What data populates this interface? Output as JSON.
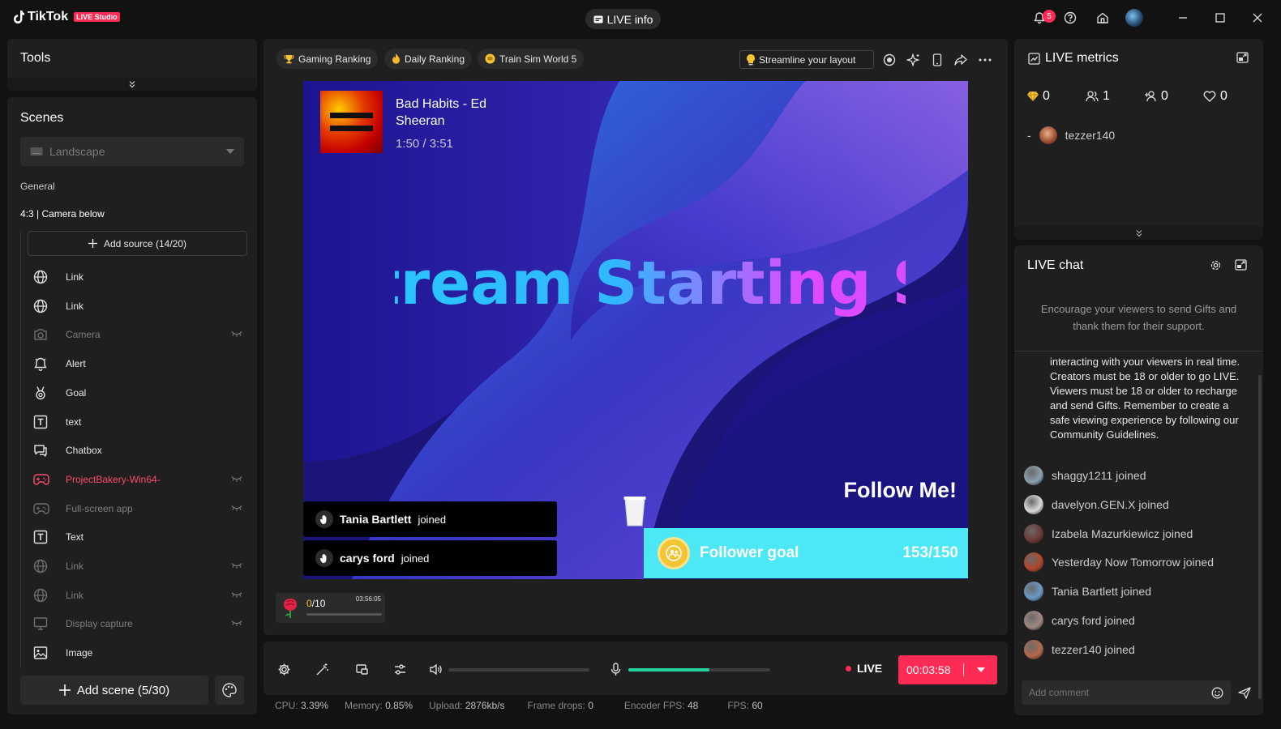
{
  "app": {
    "logo_text": "TikTok",
    "badge": "LIVE Studio",
    "live_info_label": "LIVE info",
    "notification_count": "5"
  },
  "tools": {
    "title": "Tools"
  },
  "scenes": {
    "title": "Scenes",
    "layout_selected": "Landscape",
    "group_label": "General",
    "scene_name": "4:3 | Camera below",
    "add_source_label": "Add source (14/20)",
    "sources": [
      {
        "label": "Link",
        "icon": "globe-icon",
        "state": "normal"
      },
      {
        "label": "Link",
        "icon": "globe-icon",
        "state": "normal"
      },
      {
        "label": "Camera",
        "icon": "camera-icon",
        "state": "hidden"
      },
      {
        "label": "Alert",
        "icon": "bell-icon",
        "state": "normal"
      },
      {
        "label": "Goal",
        "icon": "medal-icon",
        "state": "normal"
      },
      {
        "label": "text",
        "icon": "text-icon",
        "state": "normal"
      },
      {
        "label": "Chatbox",
        "icon": "chat-icon",
        "state": "normal"
      },
      {
        "label": "ProjectBakery-Win64-",
        "icon": "gamepad-icon",
        "state": "error"
      },
      {
        "label": "Full-screen app",
        "icon": "gamepad-icon",
        "state": "hidden"
      },
      {
        "label": "Text",
        "icon": "text-icon",
        "state": "normal"
      },
      {
        "label": "Link",
        "icon": "globe-icon",
        "state": "hidden"
      },
      {
        "label": "Link",
        "icon": "globe-icon",
        "state": "hidden"
      },
      {
        "label": "Display capture",
        "icon": "monitor-icon",
        "state": "hidden"
      },
      {
        "label": "Image",
        "icon": "image-icon",
        "state": "normal"
      }
    ],
    "add_scene_label": "Add scene (5/30)"
  },
  "preview": {
    "chips": [
      {
        "label": "Gaming Ranking",
        "icon": "trophy-icon"
      },
      {
        "label": "Daily Ranking",
        "icon": "flame-icon"
      },
      {
        "label": "Train Sim World 5",
        "icon": "game-icon"
      }
    ],
    "streamline_label": "Streamline your layout",
    "song_title": "Bad Habits - Ed Sheeran",
    "song_time": "1:50 / 3:51",
    "banner_text": "Stream Starting Soon!!!! Stream Starting Soon",
    "follow_text": "Follow Me!",
    "joins": [
      {
        "name": "Tania Bartlett",
        "action": "joined"
      },
      {
        "name": "carys ford",
        "action": "joined"
      }
    ],
    "goal_label": "Follower goal",
    "goal_count": "153/150",
    "goal_progress": 1.0,
    "rose_widget": {
      "current": "0",
      "total": "/10",
      "time": "03:56:05"
    }
  },
  "controls": {
    "volume_level": 0,
    "mic_level": 0.57,
    "live_label": "LIVE",
    "timer": "00:03:58"
  },
  "status": [
    {
      "label": "CPU:",
      "value": "3.39%"
    },
    {
      "label": "Memory:",
      "value": "0.85%"
    },
    {
      "label": "Upload:",
      "value": "2876kb/s"
    },
    {
      "label": "Frame drops:",
      "value": "0"
    },
    {
      "label": "Encoder FPS:",
      "value": "48"
    },
    {
      "label": "FPS:",
      "value": "60"
    }
  ],
  "metrics": {
    "title": "LIVE metrics",
    "diamonds": "0",
    "viewers": "1",
    "new_followers": "0",
    "likes": "0",
    "top_viewer_rank": "-",
    "top_viewer_name": "tezzer140"
  },
  "chat": {
    "title": "LIVE chat",
    "info": "Encourage your viewers to send Gifts and thank them for their support.",
    "system_message": "interacting with your viewers in real time. Creators must be 18 or older to go LIVE. Viewers must be 18 or older to recharge and send Gifts. Remember to create a safe viewing experience by following our Community Guidelines.",
    "messages": [
      {
        "user": "shaggy1211",
        "text": "joined",
        "color": "#8aa0b0"
      },
      {
        "user": "davelyon.GEN.X",
        "text": "joined",
        "color": "#d9d9d9"
      },
      {
        "user": "Izabela Mazurkiewicz",
        "text": "joined",
        "color": "#6b3a35"
      },
      {
        "user": "Yesterday Now Tomorrow",
        "text": "joined",
        "color": "#b1472a"
      },
      {
        "user": "Tania Bartlett",
        "text": "joined",
        "color": "#6a9ac4"
      },
      {
        "user": "carys ford",
        "text": "joined",
        "color": "#a08880"
      },
      {
        "user": "tezzer140",
        "text": "joined",
        "color": "#b4694a"
      }
    ],
    "comment_placeholder": "Add comment"
  }
}
